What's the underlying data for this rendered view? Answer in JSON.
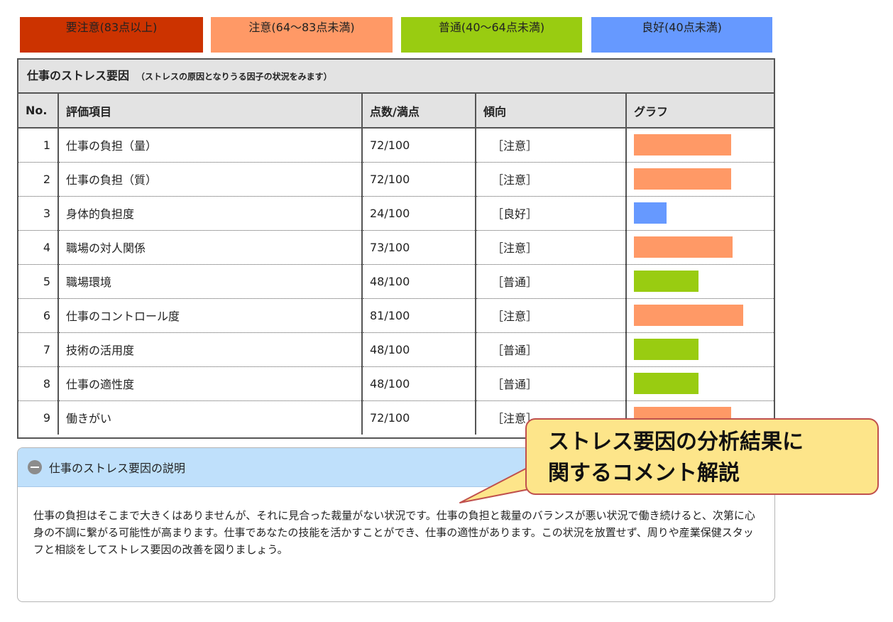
{
  "legend": [
    {
      "label": "要注意(83点以上)",
      "color": "#cc3300"
    },
    {
      "label": "注意(64〜83点未満)",
      "color": "#ff9966"
    },
    {
      "label": "普通(40〜64点未満)",
      "color": "#99cc11"
    },
    {
      "label": "良好(40点未満)",
      "color": "#6699ff"
    }
  ],
  "panel": {
    "title": "仕事のストレス要因",
    "subtitle": "（ストレスの原因となりうる因子の状況をみます）"
  },
  "table": {
    "headers": [
      "No.",
      "評価項目",
      "点数/満点",
      "傾向",
      "グラフ"
    ],
    "rows": [
      {
        "no": "1",
        "item": "仕事の負担（量）",
        "score": "72/100",
        "trend": "［注意］",
        "value": 72,
        "color": "#ff9966"
      },
      {
        "no": "2",
        "item": "仕事の負担（質）",
        "score": "72/100",
        "trend": "［注意］",
        "value": 72,
        "color": "#ff9966"
      },
      {
        "no": "3",
        "item": "身体的負担度",
        "score": "24/100",
        "trend": "［良好］",
        "value": 24,
        "color": "#6699ff"
      },
      {
        "no": "4",
        "item": "職場の対人関係",
        "score": "73/100",
        "trend": "［注意］",
        "value": 73,
        "color": "#ff9966"
      },
      {
        "no": "5",
        "item": "職場環境",
        "score": "48/100",
        "trend": "［普通］",
        "value": 48,
        "color": "#99cc11"
      },
      {
        "no": "6",
        "item": "仕事のコントロール度",
        "score": "81/100",
        "trend": "［注意］",
        "value": 81,
        "color": "#ff9966"
      },
      {
        "no": "7",
        "item": "技術の活用度",
        "score": "48/100",
        "trend": "［普通］",
        "value": 48,
        "color": "#99cc11"
      },
      {
        "no": "8",
        "item": "仕事の適性度",
        "score": "48/100",
        "trend": "［普通］",
        "value": 48,
        "color": "#99cc11"
      },
      {
        "no": "9",
        "item": "働きがい",
        "score": "72/100",
        "trend": "［注意］",
        "value": 72,
        "color": "#ff9966"
      }
    ]
  },
  "explanation": {
    "icon": "minus-circle-icon",
    "heading": "仕事のストレス要因の説明",
    "body": "仕事の負担はそこまで大きくはありませんが、それに見合った裁量がない状況です。仕事の負担と裁量のバランスが悪い状況で働き続けると、次第に心身の不調に繋がる可能性が高まります。仕事であなたの技能を活かすことができ、仕事の適性があります。この状況を放置せず、周りや産業保健スタッフと相談をしてストレス要因の改善を図りましょう。"
  },
  "callout": {
    "line1": "ストレス要因の分析結果に",
    "line2": "関するコメント解説"
  }
}
